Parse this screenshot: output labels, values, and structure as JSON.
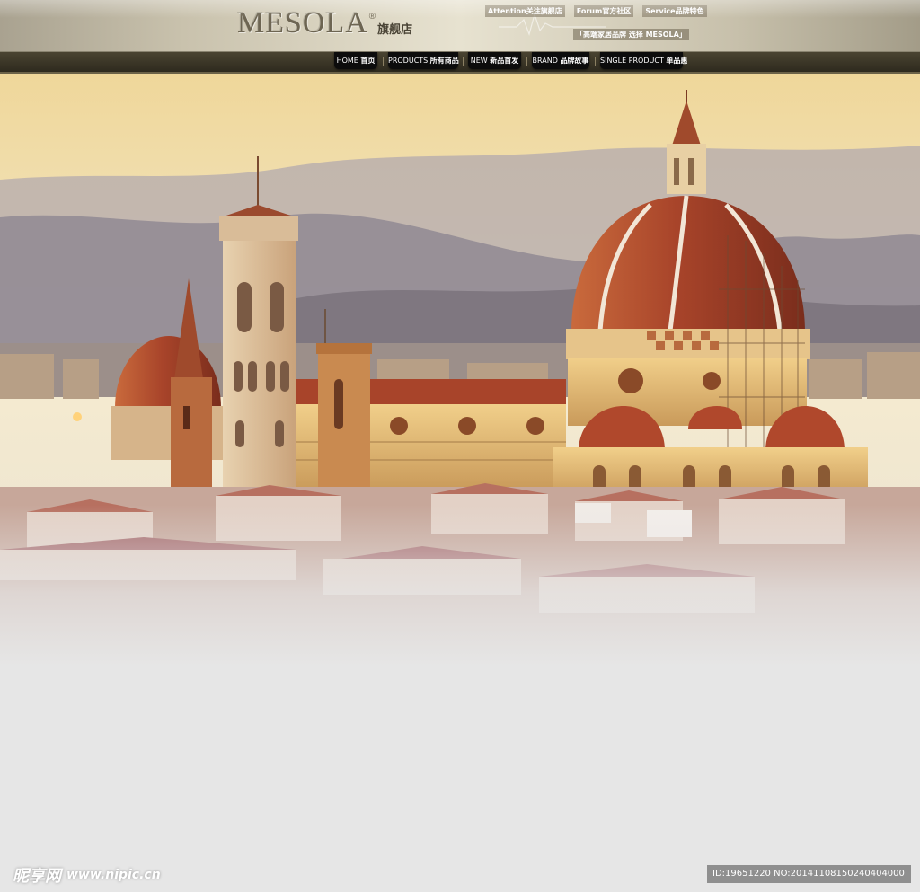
{
  "header": {
    "logo": "MESOLA",
    "registered_mark": "®",
    "store_name": "旗舰店",
    "top_links": [
      {
        "label": "Attention关注旗舰店"
      },
      {
        "label": "Forum官方社区"
      },
      {
        "label": "Service品牌特色"
      }
    ],
    "slogan": "「高端家居品牌 选择 MESOLA」"
  },
  "nav": {
    "items": [
      {
        "en": "HOME",
        "cn": "首页"
      },
      {
        "en": "PRODUCTS",
        "cn": "所有商品"
      },
      {
        "en": "NEW",
        "cn": "新品首发"
      },
      {
        "en": "BRAND",
        "cn": "品牌故事"
      },
      {
        "en": "SINGLE PRODUCT",
        "cn": "单品惠"
      }
    ]
  },
  "watermark": {
    "site_cn": "昵享网",
    "site_url": "www.nipic.cn",
    "image_id": "ID:19651220 NO:20141108150240404000"
  },
  "colors": {
    "page_bg": "#e6e6e6",
    "nav_bg": "#2e2a1e",
    "nav_button": "#0c0c0c",
    "dome": "#a8442a",
    "sky_top": "#efe2b4"
  }
}
